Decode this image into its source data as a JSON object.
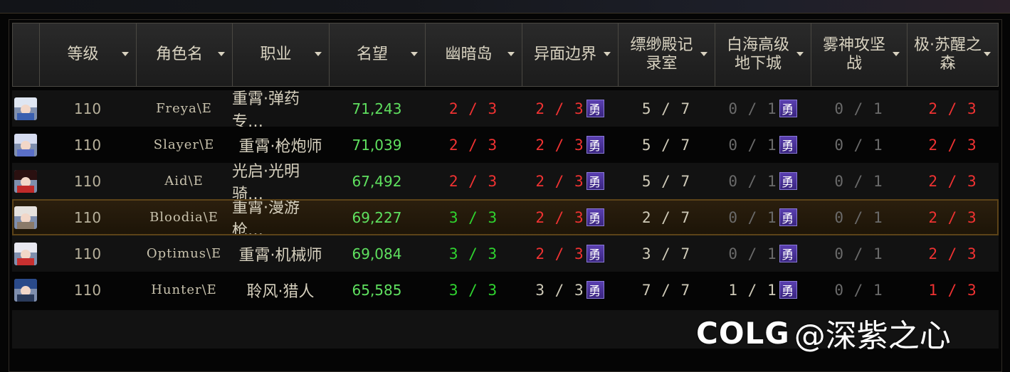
{
  "header": {
    "columns": [
      {
        "label": ""
      },
      {
        "label": "等级"
      },
      {
        "label": "角色名"
      },
      {
        "label": "职业"
      },
      {
        "label": "名望"
      },
      {
        "label": "幽暗岛"
      },
      {
        "label": "异面边界"
      },
      {
        "label": "缥缈殿记录室"
      },
      {
        "label": "白海高级地下城"
      },
      {
        "label": "雾神攻坚战"
      },
      {
        "label": "极·苏醒之森"
      }
    ]
  },
  "badge_label": "勇",
  "rows": [
    {
      "level": "110",
      "name": "Freya\\E",
      "job": "重霄·弹药专…",
      "fame": "71,243",
      "youan": "2 / 3",
      "yimian": "2 / 3",
      "piaomiao": "5 / 7",
      "baihai": "0 / 1",
      "wushen": "0 / 1",
      "suxing": "2 / 3"
    },
    {
      "level": "110",
      "name": "Slayer\\E",
      "job": "重霄·枪炮师",
      "fame": "71,039",
      "youan": "2 / 3",
      "yimian": "2 / 3",
      "piaomiao": "5 / 7",
      "baihai": "0 / 1",
      "wushen": "0 / 1",
      "suxing": "2 / 3"
    },
    {
      "level": "110",
      "name": "Aid\\E",
      "job": "光启·光明骑…",
      "fame": "67,492",
      "youan": "2 / 3",
      "yimian": "2 / 3",
      "piaomiao": "5 / 7",
      "baihai": "0 / 1",
      "wushen": "0 / 1",
      "suxing": "2 / 3"
    },
    {
      "level": "110",
      "name": "Bloodia\\E",
      "job": "重霄·漫游枪…",
      "fame": "69,227",
      "youan": "3 / 3",
      "yimian": "2 / 3",
      "piaomiao": "2 / 7",
      "baihai": "0 / 1",
      "wushen": "0 / 1",
      "suxing": "2 / 3"
    },
    {
      "level": "110",
      "name": "Optimus\\E",
      "job": "重霄·机械师",
      "fame": "69,084",
      "youan": "3 / 3",
      "yimian": "2 / 3",
      "piaomiao": "3 / 7",
      "baihai": "0 / 1",
      "wushen": "0 / 1",
      "suxing": "2 / 3"
    },
    {
      "level": "110",
      "name": "Hunter\\E",
      "job": "聆风·猎人",
      "fame": "65,585",
      "youan": "3 / 3",
      "yimian": "3 / 3",
      "piaomiao": "7 / 7",
      "baihai": "1 / 1",
      "wushen": "0 / 1",
      "suxing": "1 / 3"
    }
  ],
  "colors": {
    "incomplete": "#f03232",
    "complete": "#2fd32f",
    "none": "#6a6a6a",
    "fame": "#5fe05f",
    "badge": "#4a2f98"
  },
  "watermark": {
    "logo": "COLG",
    "text": "@深紫之心"
  }
}
